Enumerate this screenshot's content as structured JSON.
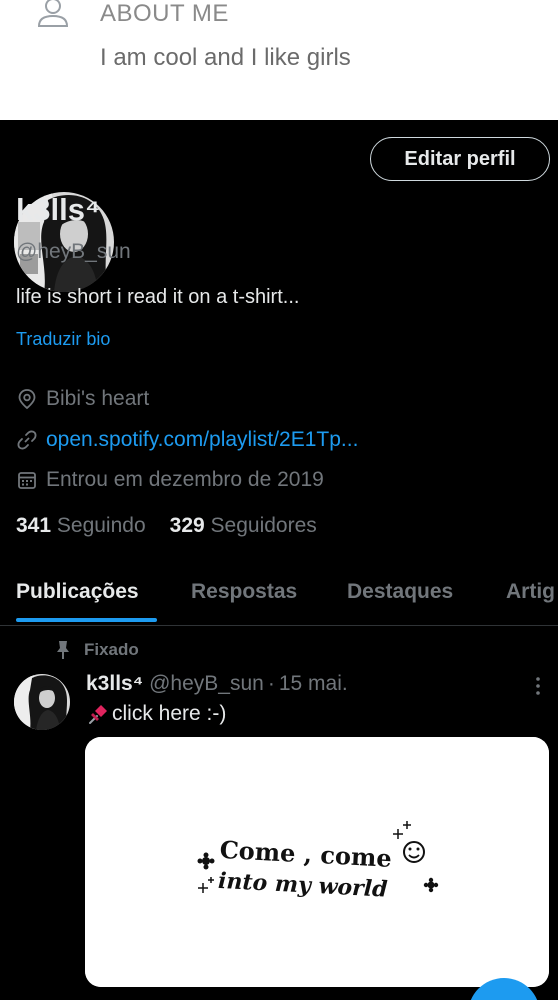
{
  "about": {
    "title": "ABOUT ME",
    "text": "I am cool and I like girls"
  },
  "profile": {
    "edit_button": "Editar perfil",
    "display_name": "k3lls⁴",
    "handle": "@heyB_sun",
    "bio": "life is short i read it on a t-shirt...",
    "translate_link": "Traduzir bio",
    "location": "Bibi's heart",
    "website": "open.spotify.com/playlist/2E1Tp...",
    "joined": "Entrou em dezembro de 2019",
    "following_count": "341",
    "following_label": "Seguindo",
    "followers_count": "329",
    "followers_label": "Seguidores"
  },
  "tabs": [
    {
      "label": "Publicações",
      "active": true
    },
    {
      "label": "Respostas",
      "active": false
    },
    {
      "label": "Destaques",
      "active": false
    },
    {
      "label": "Artig",
      "active": false
    }
  ],
  "post": {
    "pinned_label": "Fixado",
    "author_name": "k3lls⁴",
    "author_handle": "@heyB_sun",
    "separator": "·",
    "date": "15 mai.",
    "text": "click here :-)",
    "image_text_line1": "Come , come",
    "image_text_line2": "into my world"
  },
  "icons": {
    "about": "person-icon",
    "location": "location-pin-icon",
    "link": "link-icon",
    "joined": "calendar-icon",
    "pinned": "pin-icon",
    "more": "more-vertical-icon",
    "post_emoji": "pushpin-emoji-icon"
  },
  "colors": {
    "accent": "#1d9bf0",
    "background": "#000000",
    "secondary_text": "#71767b",
    "primary_text": "#e7e9ea"
  }
}
